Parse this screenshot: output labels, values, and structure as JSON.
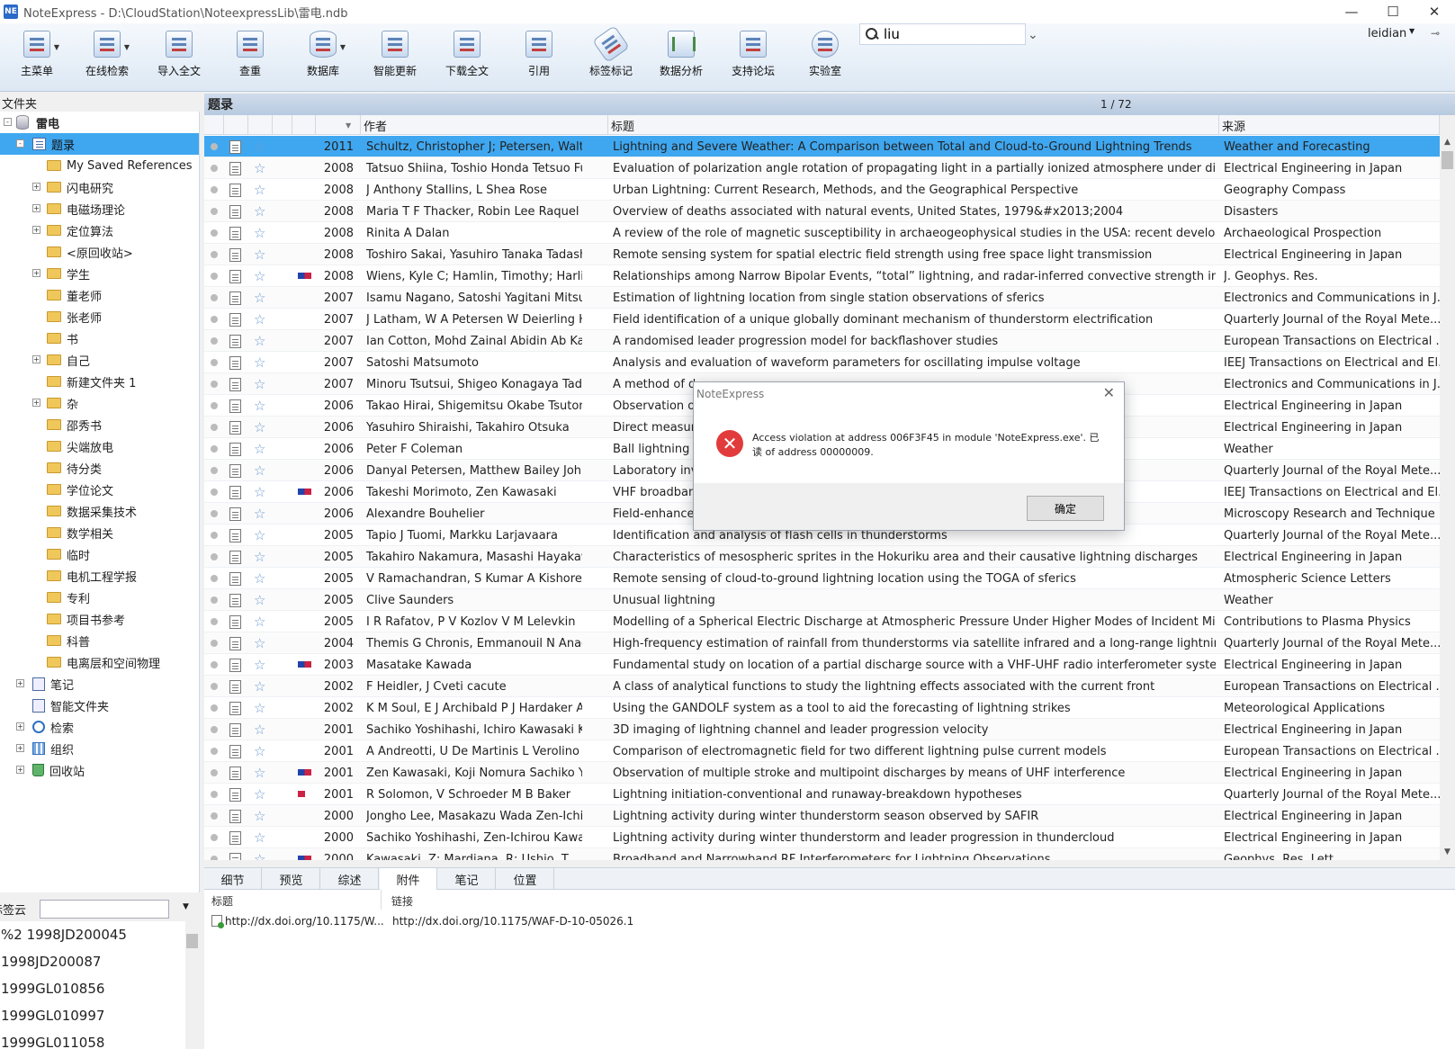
{
  "window": {
    "title": "NoteExpress - D:\\CloudStation\\NoteexpressLib\\雷电.ndb",
    "app_icon": "NE"
  },
  "toolbar": [
    {
      "label": "主菜单",
      "icon": "main-menu-icon",
      "dropdown": true
    },
    {
      "label": "在线检索",
      "icon": "online-search-icon",
      "dropdown": true
    },
    {
      "label": "导入全文",
      "icon": "import-fulltext-icon",
      "dropdown": false
    },
    {
      "label": "查重",
      "icon": "duplicate-check-icon",
      "dropdown": false
    },
    {
      "label": "数据库",
      "icon": "database-icon",
      "dropdown": true
    },
    {
      "label": "智能更新",
      "icon": "smart-update-icon",
      "dropdown": false
    },
    {
      "label": "下载全文",
      "icon": "download-fulltext-icon",
      "dropdown": false
    },
    {
      "label": "引用",
      "icon": "cite-icon",
      "dropdown": false
    },
    {
      "label": "标签标记",
      "icon": "tag-icon",
      "dropdown": false
    },
    {
      "label": "数据分析",
      "icon": "data-analysis-icon",
      "dropdown": false
    },
    {
      "label": "支持论坛",
      "icon": "forum-icon",
      "dropdown": false
    },
    {
      "label": "实验室",
      "icon": "lab-icon",
      "dropdown": false
    }
  ],
  "search": {
    "value": "liu"
  },
  "user": {
    "name": "leidian"
  },
  "left": {
    "folder_header": "文件夹",
    "tree": [
      {
        "label": "雷电",
        "level": 0,
        "icon": "database-icon",
        "exp": "-",
        "bold": true
      },
      {
        "label": "题录",
        "level": 1,
        "icon": "list-icon",
        "exp": "-",
        "selected": true
      },
      {
        "label": "My Saved References",
        "level": 2,
        "icon": "folder-icon",
        "exp": ""
      },
      {
        "label": "闪电研究",
        "level": 2,
        "icon": "folder-icon",
        "exp": "+"
      },
      {
        "label": "电磁场理论",
        "level": 2,
        "icon": "folder-icon",
        "exp": "+"
      },
      {
        "label": "定位算法",
        "level": 2,
        "icon": "folder-icon",
        "exp": "+"
      },
      {
        "label": "<原回收站>",
        "level": 2,
        "icon": "folder-icon",
        "exp": ""
      },
      {
        "label": "学生",
        "level": 2,
        "icon": "folder-icon",
        "exp": "+"
      },
      {
        "label": "董老师",
        "level": 2,
        "icon": "folder-icon",
        "exp": ""
      },
      {
        "label": "张老师",
        "level": 2,
        "icon": "folder-icon",
        "exp": ""
      },
      {
        "label": "书",
        "level": 2,
        "icon": "folder-icon",
        "exp": ""
      },
      {
        "label": "自己",
        "level": 2,
        "icon": "folder-icon",
        "exp": "+"
      },
      {
        "label": "新建文件夹 1",
        "level": 2,
        "icon": "folder-icon",
        "exp": ""
      },
      {
        "label": "杂",
        "level": 2,
        "icon": "folder-icon",
        "exp": "+"
      },
      {
        "label": "邵秀书",
        "level": 2,
        "icon": "folder-icon",
        "exp": ""
      },
      {
        "label": "尖端放电",
        "level": 2,
        "icon": "folder-icon",
        "exp": ""
      },
      {
        "label": "待分类",
        "level": 2,
        "icon": "folder-icon",
        "exp": ""
      },
      {
        "label": "学位论文",
        "level": 2,
        "icon": "folder-icon",
        "exp": ""
      },
      {
        "label": "数据采集技术",
        "level": 2,
        "icon": "folder-icon",
        "exp": ""
      },
      {
        "label": "数学相关",
        "level": 2,
        "icon": "folder-icon",
        "exp": ""
      },
      {
        "label": "临时",
        "level": 2,
        "icon": "folder-icon",
        "exp": ""
      },
      {
        "label": "电机工程学报",
        "level": 2,
        "icon": "folder-icon",
        "exp": ""
      },
      {
        "label": "专利",
        "level": 2,
        "icon": "folder-icon",
        "exp": ""
      },
      {
        "label": "项目书参考",
        "level": 2,
        "icon": "folder-icon",
        "exp": ""
      },
      {
        "label": "科普",
        "level": 2,
        "icon": "folder-icon",
        "exp": ""
      },
      {
        "label": "电离层和空间物理",
        "level": 2,
        "icon": "folder-icon",
        "exp": ""
      },
      {
        "label": "笔记",
        "level": 1,
        "icon": "note-icon",
        "exp": "+"
      },
      {
        "label": "智能文件夹",
        "level": 1,
        "icon": "note-icon",
        "exp": ""
      },
      {
        "label": "检索",
        "level": 1,
        "icon": "search-icon",
        "exp": "+"
      },
      {
        "label": "组织",
        "level": 1,
        "icon": "org-icon",
        "exp": "+"
      },
      {
        "label": "回收站",
        "level": 1,
        "icon": "trash-icon",
        "exp": "+"
      }
    ],
    "tagcloud_label": "标签云",
    "tags": [
      "%2 1998JD200045",
      "1998JD200087",
      "1999GL010856",
      "1999GL010997",
      "1999GL011058"
    ]
  },
  "main": {
    "header": "题录",
    "page": "1 / 72",
    "columns": {
      "author": "作者",
      "title": "标题",
      "source": "来源"
    },
    "rows": [
      {
        "year": "2011",
        "author": "Schultz, Christopher J; Petersen, Walter ...",
        "title": "Lightning and Severe Weather: A Comparison between Total and Cloud-to-Ground Lightning Trends",
        "source": "Weather and Forecasting",
        "flag": "",
        "selected": true
      },
      {
        "year": "2008",
        "author": "Tatsuo Shiina, Toshio Honda Tetsuo Fuk...",
        "title": "Evaluation of polarization angle rotation of propagating light in a partially ionized atmosphere under discha...",
        "source": "Electrical Engineering in Japan",
        "flag": ""
      },
      {
        "year": "2008",
        "author": "J Anthony Stallins, L Shea Rose",
        "title": "Urban Lightning: Current Research, Methods, and the Geographical Perspective",
        "source": "Geography Compass",
        "flag": ""
      },
      {
        "year": "2008",
        "author": "Maria T F Thacker, Robin Lee Raquel I Sa...",
        "title": "Overview of deaths associated with natural events, United States, 1979&#x2013;2004",
        "source": "Disasters",
        "flag": ""
      },
      {
        "year": "2008",
        "author": "Rinita A Dalan",
        "title": "A review of the role of magnetic susceptibility in archaeogeophysical studies in the USA: recent developme...",
        "source": "Archaeological Prospection",
        "flag": ""
      },
      {
        "year": "2008",
        "author": "Toshiro Sakai, Yasuhiro Tanaka Tadashi F...",
        "title": "Remote sensing system for spatial electric field strength using free space light transmission",
        "source": "Electrical Engineering in Japan",
        "flag": ""
      },
      {
        "year": "2008",
        "author": "Wiens, Kyle C; Hamlin, Timothy; Harlin, J...",
        "title": "Relationships among Narrow Bipolar Events, “total” lightning, and radar-inferred convective strength in ...",
        "source": "J. Geophys. Res.",
        "flag": "bluered"
      },
      {
        "year": "2007",
        "author": "Isamu Nagano, Satoshi Yagitani Mitsuno...",
        "title": "Estimation of lightning location from single station observations of sferics",
        "source": "Electronics and Communications in J...",
        "flag": ""
      },
      {
        "year": "2007",
        "author": "J Latham, W A Petersen W Deierling H J ...",
        "title": "Field identification of a unique globally dominant mechanism of thunderstorm electrification",
        "source": "Quarterly Journal of the Royal Mete...",
        "flag": ""
      },
      {
        "year": "2007",
        "author": "Ian Cotton, Mohd Zainal Abidin Ab Kadir",
        "title": "A randomised leader progression model for backflashover studies",
        "source": "European Transactions on Electrical ...",
        "flag": ""
      },
      {
        "year": "2007",
        "author": "Satoshi Matsumoto",
        "title": "Analysis and evaluation of waveform parameters for oscillating impulse voltage",
        "source": "IEEJ Transactions on Electrical and El...",
        "flag": ""
      },
      {
        "year": "2007",
        "author": "Minoru Tsutsui, Shigeo Konagaya Taday...",
        "title": "A method of d",
        "source": "Electronics and Communications in J...",
        "flag": ""
      },
      {
        "year": "2006",
        "author": "Takao Hirai, Shigemitsu Okabe Tsutomu ...",
        "title": "Observation o",
        "source": "Electrical Engineering in Japan",
        "flag": ""
      },
      {
        "year": "2006",
        "author": "Yasuhiro Shiraishi, Takahiro Otsuka",
        "title": "Direct measure",
        "source": "Electrical Engineering in Japan",
        "flag": ""
      },
      {
        "year": "2006",
        "author": "Peter F Coleman",
        "title": "Ball lightning f",
        "source": "Weather",
        "flag": ""
      },
      {
        "year": "2006",
        "author": "Danyal Petersen, Matthew Bailey John H...",
        "title": "Laboratory inv",
        "source": "Quarterly Journal of the Royal Mete...",
        "flag": ""
      },
      {
        "year": "2006",
        "author": "Takeshi Morimoto, Zen Kawasaki",
        "title": "VHF broadban",
        "source": "IEEJ Transactions on Electrical and El...",
        "flag": "bluered"
      },
      {
        "year": "2006",
        "author": "Alexandre Bouhelier",
        "title": "Field-enhanced",
        "source": "Microscopy Research and Technique",
        "flag": ""
      },
      {
        "year": "2005",
        "author": "Tapio J Tuomi, Markku Larjavaara",
        "title": "Identification and analysis of flash cells in thunderstorms",
        "source": "Quarterly Journal of the Royal Mete...",
        "flag": ""
      },
      {
        "year": "2005",
        "author": "Takahiro Nakamura, Masashi Hayakawa",
        "title": "Characteristics of mesospheric sprites in the Hokuriku area and their causative lightning discharges",
        "source": "Electrical Engineering in Japan",
        "flag": ""
      },
      {
        "year": "2005",
        "author": "V Ramachandran, S Kumar A Kishore",
        "title": "Remote sensing of cloud-to-ground lightning location using the TOGA of sferics",
        "source": "Atmospheric Science Letters",
        "flag": ""
      },
      {
        "year": "2005",
        "author": "Clive Saunders",
        "title": "Unusual lightning",
        "source": "Weather",
        "flag": ""
      },
      {
        "year": "2005",
        "author": "I R Rafatov, P V Kozlov V M Lelevkin",
        "title": "Modelling of a Spherical Electric Discharge at Atmospheric Pressure Under Higher Modes of Incident Micr...",
        "source": "Contributions to Plasma Physics",
        "flag": ""
      },
      {
        "year": "2004",
        "author": "Themis G Chronis, Emmanouil N Anagno...",
        "title": "High-frequency estimation of rainfall from thunderstorms via satellite infrared and a long-range lightning ...",
        "source": "Quarterly Journal of the Royal Mete...",
        "flag": ""
      },
      {
        "year": "2003",
        "author": "Masatake Kawada",
        "title": "Fundamental study on location of a partial discharge source with a VHF-UHF radio interferometer system",
        "source": "Electrical Engineering in Japan",
        "flag": "bluered"
      },
      {
        "year": "2002",
        "author": "F Heidler, J Cveti cacute",
        "title": "A class of analytical functions to study the lightning effects associated with the current front",
        "source": "European Transactions on Electrical ...",
        "flag": ""
      },
      {
        "year": "2002",
        "author": "K M Soul, E J Archibald P J Hardaker A H...",
        "title": "Using the GANDOLF system as a tool to aid the forecasting of lightning strikes",
        "source": "Meteorological Applications",
        "flag": ""
      },
      {
        "year": "2001",
        "author": "Sachiko Yoshihashi, Ichiro Kawasaki Kenj...",
        "title": "3D imaging of lightning channel and leader progression velocity",
        "source": "Electrical Engineering in Japan",
        "flag": ""
      },
      {
        "year": "2001",
        "author": "A Andreotti, U De Martinis L Verolino",
        "title": "Comparison of electromagnetic field for two different lightning pulse current models",
        "source": "European Transactions on Electrical ...",
        "flag": ""
      },
      {
        "year": "2001",
        "author": "Zen Kawasaki, Koji Nomura Sachiko Yos...",
        "title": "Observation of multiple stroke and multipoint discharges by means of UHF interference",
        "source": "Electrical Engineering in Japan",
        "flag": "bluered"
      },
      {
        "year": "2001",
        "author": "R Solomon, V Schroeder M B Baker",
        "title": "Lightning initiation-conventional and runaway-breakdown hypotheses",
        "source": "Quarterly Journal of the Royal Mete...",
        "flag": "red"
      },
      {
        "year": "2000",
        "author": "Jongho Lee, Masakazu Wada Zen-Ichiro ...",
        "title": "Lightning activity during winter thunderstorm season observed by SAFIR",
        "source": "Electrical Engineering in Japan",
        "flag": ""
      },
      {
        "year": "2000",
        "author": "Sachiko Yoshihashi, Zen-Ichirou Kawasa...",
        "title": "Lightning activity during winter thunderstorm and leader progression in thundercloud",
        "source": "Electrical Engineering in Japan",
        "flag": ""
      },
      {
        "year": "2000",
        "author": "Kawasaki, Z; Mardiana, R; Ushio, T",
        "title": "Broadband and Narrowband RF Interferometers for Lightning Observations",
        "source": "Geophys. Res. Lett.",
        "flag": "bluered"
      }
    ]
  },
  "dialog": {
    "title": "NoteExpress",
    "message": "Access violation at address 006F3F45 in module 'NoteExpress.exe'. 已读 of address 00000009.",
    "ok": "确定"
  },
  "bottom": {
    "tabs": [
      "细节",
      "预览",
      "综述",
      "附件",
      "笔记",
      "位置"
    ],
    "active_tab": "附件",
    "attach_header": {
      "title": "标题",
      "link": "链接"
    },
    "attach_rows": [
      {
        "title": "http://dx.doi.org/10.1175/W...",
        "link": "http://dx.doi.org/10.1175/WAF-D-10-05026.1"
      }
    ]
  }
}
